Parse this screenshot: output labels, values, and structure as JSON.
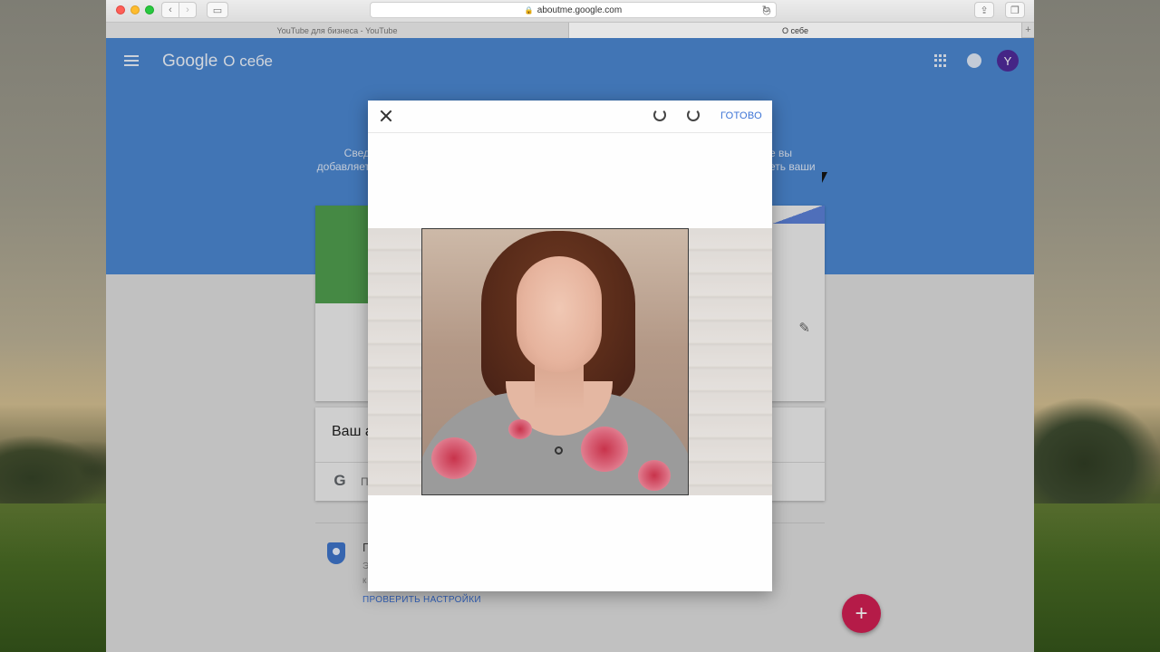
{
  "browser": {
    "url": "aboutme.google.com",
    "tabs": [
      {
        "label": "YouTube для бизнеса - YouTube",
        "active": false
      },
      {
        "label": "О себе",
        "active": true
      }
    ]
  },
  "header": {
    "brand": "Google",
    "section": "О себе",
    "avatar_letter": "Y"
  },
  "intro": {
    "left_line1": "Свед",
    "left_line2": "добавляет",
    "right_line1": "е вы",
    "right_line2": "еть ваши"
  },
  "account_card": {
    "title_partial": "Ваш а",
    "row_partial": "П"
  },
  "privacy": {
    "title_partial": "П",
    "line1_partial": "Э",
    "line2_partial": "к",
    "link": "ПРОВЕРИТЬ НАСТРОЙКИ"
  },
  "dialog": {
    "done_label": "ГОТОВО"
  },
  "colors": {
    "header_blue": "#4a86cf",
    "fab": "#cf1f52",
    "link_blue": "#3d74d6",
    "avatar": "#4f2b99"
  },
  "icons": {
    "close": "close-icon",
    "rotate_left": "rotate-left-icon",
    "rotate_right": "rotate-right-icon",
    "edit": "pencil-icon",
    "apps": "apps-grid-icon",
    "notifications": "bell-icon",
    "fab": "plus-icon"
  }
}
